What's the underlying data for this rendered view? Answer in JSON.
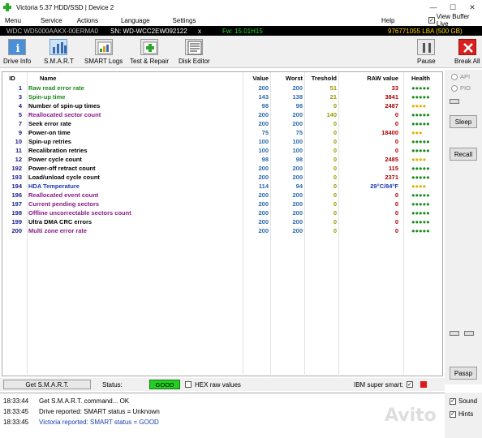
{
  "window": {
    "title": "Victoria 5.37 HDD/SSD | Device 2",
    "minimize": "—",
    "maximize": "☐",
    "close": "✕"
  },
  "menu": {
    "items": [
      "Menu",
      "Service",
      "Actions",
      "Language",
      "Settings"
    ],
    "help": "Help",
    "view_buffer_live": "View Buffer Live",
    "view_buffer_checked": "✓"
  },
  "device": {
    "model": "WDC WD5000AAKX-00ERMA0",
    "serial": "SN: WD-WCC2EW092122",
    "close": "x",
    "firmware": "Fw: 15.01H15",
    "lba": "976771055 LBA (500 GB)"
  },
  "toolbar": {
    "drive_info": "Drive Info",
    "smart": "S.M.A.R.T",
    "smart_logs": "SMART Logs",
    "test_repair": "Test & Repair",
    "disk_editor": "Disk Editor",
    "pause": "Pause",
    "break_all": "Break All"
  },
  "table": {
    "headers": {
      "id": "ID",
      "name": "Name",
      "value": "Value",
      "worst": "Worst",
      "treshold": "Treshold",
      "raw": "RAW value",
      "health": "Health"
    },
    "rows": [
      {
        "id": "1",
        "name": "Raw read error rate",
        "value": "200",
        "worst": "200",
        "tresh": "51",
        "raw": "33",
        "health": "●●●●●",
        "name_color": "#1a8a1a",
        "health_color": "#1a8a1a"
      },
      {
        "id": "3",
        "name": "Spin-up time",
        "value": "143",
        "worst": "138",
        "tresh": "21",
        "raw": "3841",
        "health": "●●●●●",
        "name_color": "#1a8a1a",
        "health_color": "#1a8a1a"
      },
      {
        "id": "4",
        "name": "Number of spin-up times",
        "value": "98",
        "worst": "98",
        "tresh": "0",
        "raw": "2487",
        "health": "●●●●",
        "name_color": "#000000",
        "health_color": "#e0b000"
      },
      {
        "id": "5",
        "name": "Reallocated sector count",
        "value": "200",
        "worst": "200",
        "tresh": "140",
        "raw": "0",
        "health": "●●●●●",
        "name_color": "#8a1a8a",
        "health_color": "#1a8a1a"
      },
      {
        "id": "7",
        "name": "Seek error rate",
        "value": "200",
        "worst": "200",
        "tresh": "0",
        "raw": "0",
        "health": "●●●●●",
        "name_color": "#000000",
        "health_color": "#1a8a1a"
      },
      {
        "id": "9",
        "name": "Power-on time",
        "value": "75",
        "worst": "75",
        "tresh": "0",
        "raw": "18400",
        "health": "●●●",
        "name_color": "#000000",
        "health_color": "#e0b000"
      },
      {
        "id": "10",
        "name": "Spin-up retries",
        "value": "100",
        "worst": "100",
        "tresh": "0",
        "raw": "0",
        "health": "●●●●●",
        "name_color": "#000000",
        "health_color": "#1a8a1a"
      },
      {
        "id": "11",
        "name": "Recalibration retries",
        "value": "100",
        "worst": "100",
        "tresh": "0",
        "raw": "0",
        "health": "●●●●●",
        "name_color": "#000000",
        "health_color": "#1a8a1a"
      },
      {
        "id": "12",
        "name": "Power cycle count",
        "value": "98",
        "worst": "98",
        "tresh": "0",
        "raw": "2485",
        "health": "●●●●",
        "name_color": "#000000",
        "health_color": "#e0b000"
      },
      {
        "id": "192",
        "name": "Power-off retract count",
        "value": "200",
        "worst": "200",
        "tresh": "0",
        "raw": "115",
        "health": "●●●●●",
        "name_color": "#000000",
        "health_color": "#1a8a1a"
      },
      {
        "id": "193",
        "name": "Load/unload cycle count",
        "value": "200",
        "worst": "200",
        "tresh": "0",
        "raw": "2371",
        "health": "●●●●●",
        "name_color": "#000000",
        "health_color": "#1a8a1a"
      },
      {
        "id": "194",
        "name": "HDA Temperature",
        "value": "114",
        "worst": "94",
        "tresh": "0",
        "raw": "29°C/84°F",
        "health": "●●●●",
        "name_color": "#1a3ab0",
        "health_color": "#e0b000",
        "raw_color": "#1a3ab0"
      },
      {
        "id": "196",
        "name": "Reallocated event count",
        "value": "200",
        "worst": "200",
        "tresh": "0",
        "raw": "0",
        "health": "●●●●●",
        "name_color": "#8a1a8a",
        "health_color": "#1a8a1a"
      },
      {
        "id": "197",
        "name": "Current pending sectors",
        "value": "200",
        "worst": "200",
        "tresh": "0",
        "raw": "0",
        "health": "●●●●●",
        "name_color": "#8a1a8a",
        "health_color": "#1a8a1a"
      },
      {
        "id": "198",
        "name": "Offline uncorrectable sectors count",
        "value": "200",
        "worst": "200",
        "tresh": "0",
        "raw": "0",
        "health": "●●●●●",
        "name_color": "#8a1a8a",
        "health_color": "#1a8a1a"
      },
      {
        "id": "199",
        "name": "Ultra DMA CRC errors",
        "value": "200",
        "worst": "200",
        "tresh": "0",
        "raw": "0",
        "health": "●●●●●",
        "name_color": "#000000",
        "health_color": "#1a8a1a"
      },
      {
        "id": "200",
        "name": "Multi zone error rate",
        "value": "200",
        "worst": "200",
        "tresh": "0",
        "raw": "0",
        "health": "●●●●●",
        "name_color": "#8a1a8a",
        "health_color": "#1a8a1a"
      }
    ]
  },
  "sidebar": {
    "api": "API",
    "pio": "PIO",
    "sleep": "Sleep",
    "recall": "Recall",
    "passp": "Passp"
  },
  "statusbar": {
    "get_smart": "Get S.M.A.R.T.",
    "status_label": "Status:",
    "status_value": "GOOD",
    "hex_raw": "HEX raw values",
    "ibm_super_smart": "IBM super smart:",
    "ibm_checked": "✓"
  },
  "log": [
    {
      "time": "18:33:44",
      "msg": "Get S.M.A.R.T. command... OK",
      "color": "#000000"
    },
    {
      "time": "18:33:45",
      "msg": "Drive reported: SMART status = Unknown",
      "color": "#000000"
    },
    {
      "time": "18:33:45",
      "msg": "Victoria reported: SMART status = GOOD",
      "color": "#1a3ab0"
    }
  ],
  "sound": {
    "sound_label": "Sound",
    "hints_label": "Hints",
    "check": "✓"
  },
  "watermark": "Avito"
}
